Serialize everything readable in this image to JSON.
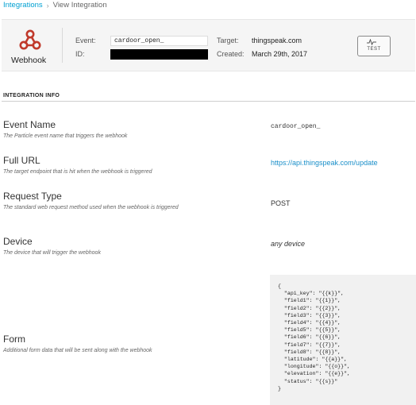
{
  "breadcrumb": {
    "parent": "Integrations",
    "separator": "›",
    "current": "View Integration"
  },
  "header": {
    "type_label": "Webhook",
    "event_label": "Event:",
    "event_value": "cardoor_open_",
    "id_label": "ID:",
    "id_value": "",
    "target_label": "Target:",
    "target_value": "thingspeak.com",
    "created_label": "Created:",
    "created_value": "March 29th, 2017",
    "test_button_label": "TEST"
  },
  "section": {
    "title": "INTEGRATION INFO"
  },
  "rows": [
    {
      "title": "Event Name",
      "description": "The Particle event name that triggers the webhook",
      "value": "cardoor_open_"
    },
    {
      "title": "Full URL",
      "description": "The target endpoint that is hit when the webhook is triggered",
      "value": "https://api.thingspeak.com/update"
    },
    {
      "title": "Request Type",
      "description": "The standard web request method used when the webhook is triggered",
      "value": "POST"
    },
    {
      "title": "Device",
      "description": "The device that will trigger the webhook",
      "value": "any device"
    },
    {
      "title": "Form",
      "description": "Additional form data that will be sent along with the webhook",
      "value": ""
    }
  ],
  "form_json": [
    "{",
    "  \"api_key\": \"{{k}}\",",
    "  \"field1\": \"{{1}}\",",
    "  \"field2\": \"{{2}}\",",
    "  \"field3\": \"{{3}}\",",
    "  \"field4\": \"{{4}}\",",
    "  \"field5\": \"{{5}}\",",
    "  \"field6\": \"{{6}}\",",
    "  \"field7\": \"{{7}}\",",
    "  \"field8\": \"{{8}}\",",
    "  \"latitude\": \"{{a}}\",",
    "  \"longitude\": \"{{o}}\",",
    "  \"elevation\": \"{{e}}\",",
    "  \"status\": \"{{s}}\"",
    "}"
  ],
  "icons": {
    "webhook": "webhook-icon",
    "test": "pulse-icon"
  },
  "colors": {
    "link": "#00a0d2",
    "header_bg": "#f5f5f5",
    "webhook_red": "#c0392b"
  }
}
